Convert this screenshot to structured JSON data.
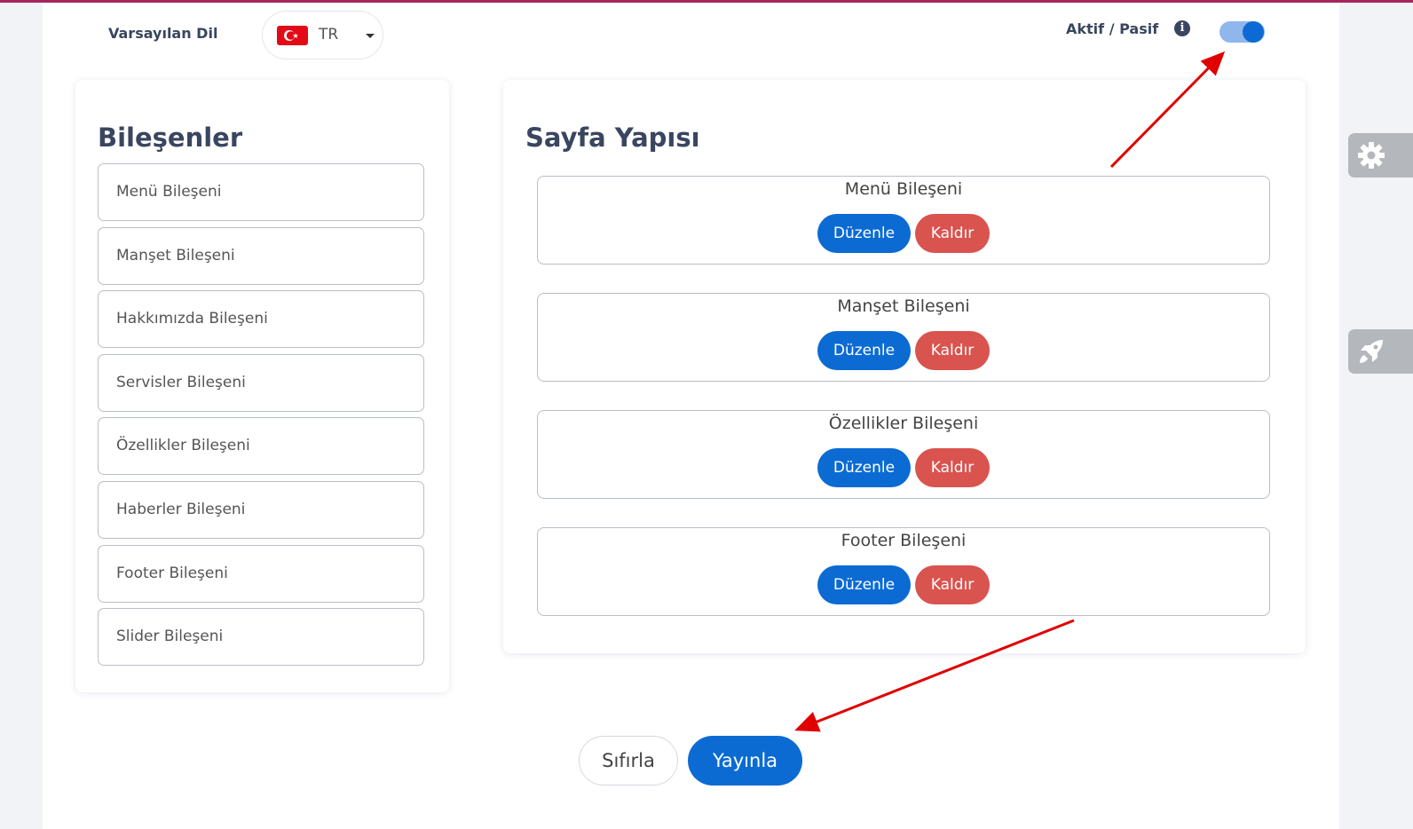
{
  "header": {
    "default_language_label": "Varsayılan Dil",
    "selected_language": "TR",
    "status_label": "Aktif / Pasif",
    "status_toggle_on": true
  },
  "components_panel": {
    "title": "Bileşenler",
    "items": [
      "Menü Bileşeni",
      "Manşet Bileşeni",
      "Hakkımızda Bileşeni",
      "Servisler Bileşeni",
      "Özellikler Bileşeni",
      "Haberler Bileşeni",
      "Footer Bileşeni",
      "Slider Bileşeni"
    ]
  },
  "structure_panel": {
    "title": "Sayfa Yapısı",
    "edit_label": "Düzenle",
    "remove_label": "Kaldır",
    "items": [
      "Menü Bileşeni",
      "Manşet Bileşeni",
      "Özellikler Bileşeni",
      "Footer Bileşeni"
    ]
  },
  "footer_actions": {
    "reset_label": "Sıfırla",
    "publish_label": "Yayınla"
  },
  "icons": {
    "info": "info-icon",
    "settings": "gear-icon",
    "launch": "rocket-icon",
    "flag": "turkey-flag-icon"
  },
  "colors": {
    "primary": "#0b6bd3",
    "danger": "#d9534f",
    "toggle_track": "#8fb7ee",
    "annotation_arrow": "#e00000",
    "top_accent": "#a5265c"
  }
}
